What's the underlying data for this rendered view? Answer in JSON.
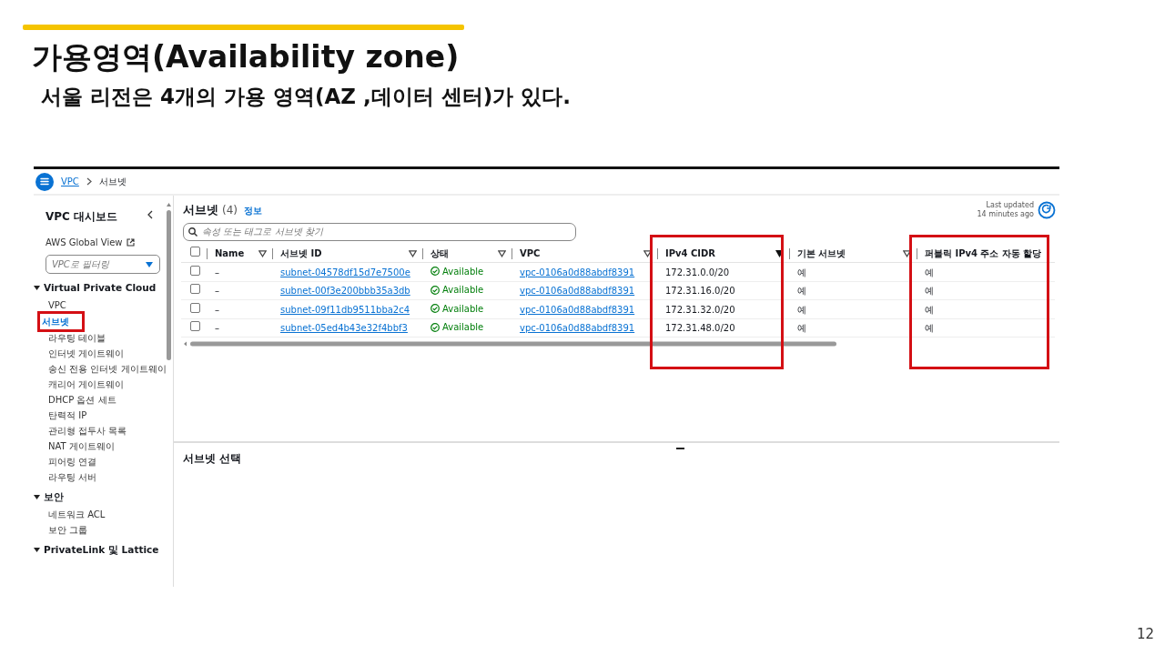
{
  "slide": {
    "title": "가용영역(Availability zone)",
    "subtitle": "서울 리전은 4개의 가용 영역(AZ ,데이터 센터)가 있다.",
    "page_number": "12"
  },
  "breadcrumb": [
    "VPC",
    "서브넷"
  ],
  "sidebar": {
    "title": "VPC 대시보드",
    "global_view": "AWS Global View",
    "filter": {
      "placeholder": "VPC로 필터링"
    },
    "sections": [
      {
        "label": "Virtual Private Cloud",
        "expanded": true,
        "items": [
          {
            "label": "VPC",
            "selected": false,
            "highlighted": false
          },
          {
            "label": "서브넷",
            "selected": true,
            "highlighted": true
          },
          {
            "label": "라우팅 테이블",
            "selected": false,
            "highlighted": false
          },
          {
            "label": "인터넷 게이트웨이",
            "selected": false,
            "highlighted": false
          },
          {
            "label": "송신 전용 인터넷 게이트웨이",
            "selected": false,
            "highlighted": false
          },
          {
            "label": "캐리어 게이트웨이",
            "selected": false,
            "highlighted": false
          },
          {
            "label": "DHCP 옵션 세트",
            "selected": false,
            "highlighted": false
          },
          {
            "label": "탄력적 IP",
            "selected": false,
            "highlighted": false
          },
          {
            "label": "관리형 접두사 목록",
            "selected": false,
            "highlighted": false
          },
          {
            "label": "NAT 게이트웨이",
            "selected": false,
            "highlighted": false
          },
          {
            "label": "피어링 연결",
            "selected": false,
            "highlighted": false
          },
          {
            "label": "라우팅 서버",
            "selected": false,
            "highlighted": false
          }
        ]
      },
      {
        "label": "보안",
        "expanded": true,
        "items": [
          {
            "label": "네트워크 ACL",
            "selected": false,
            "highlighted": false
          },
          {
            "label": "보안 그룹",
            "selected": false,
            "highlighted": false
          }
        ]
      },
      {
        "label": "PrivateLink 및 Lattice",
        "expanded": true
      }
    ]
  },
  "panel": {
    "all_selected": false,
    "title": "서브넷",
    "count": "(4)",
    "info": "정보",
    "last_updated": "Last updated",
    "last_updated_ago": "14 minutes ago",
    "search": {
      "placeholder": "속성 또는 태그로 서브넷 찾기"
    },
    "columns": [
      {
        "label": "Name",
        "sorted": false,
        "highlighted": false
      },
      {
        "label": "서브넷 ID",
        "sorted": false,
        "highlighted": false
      },
      {
        "label": "상태",
        "sorted": false,
        "highlighted": false
      },
      {
        "label": "VPC",
        "sorted": false,
        "highlighted": false
      },
      {
        "label": "IPv4 CIDR",
        "sorted": true,
        "highlighted": true
      },
      {
        "label": "기본 서브넷",
        "sorted": false,
        "highlighted": false
      },
      {
        "label": "퍼블릭 IPv4 주소 자동 할당",
        "highlighted": true
      }
    ],
    "rows": [
      {
        "selected": false,
        "name": "–",
        "subnet_id": "subnet-04578df15d7e7500e",
        "status": "Available",
        "vpc": "vpc-0106a0d88abdf8391",
        "cidr": "172.31.0.0/20",
        "default": "예",
        "public_ip": "예"
      },
      {
        "selected": false,
        "name": "–",
        "subnet_id": "subnet-00f3e200bbb35a3db",
        "status": "Available",
        "vpc": "vpc-0106a0d88abdf8391",
        "cidr": "172.31.16.0/20",
        "default": "예",
        "public_ip": "예"
      },
      {
        "selected": false,
        "name": "–",
        "subnet_id": "subnet-09f11db9511bba2c4",
        "status": "Available",
        "vpc": "vpc-0106a0d88abdf8391",
        "cidr": "172.31.32.0/20",
        "default": "예",
        "public_ip": "예"
      },
      {
        "selected": false,
        "name": "–",
        "subnet_id": "subnet-05ed4b43e32f4bbf3",
        "status": "Available",
        "vpc": "vpc-0106a0d88abdf8391",
        "cidr": "172.31.48.0/20",
        "default": "예",
        "public_ip": "예"
      }
    ]
  },
  "split_panel": {
    "title": "서브넷 선택"
  }
}
